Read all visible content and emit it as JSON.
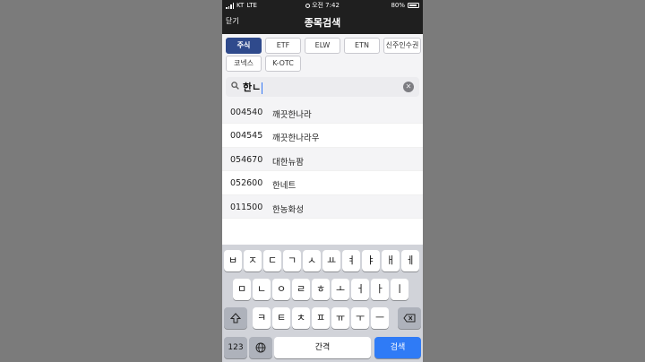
{
  "status": {
    "carrier": "KT",
    "network": "LTE",
    "time": "오전 7:42",
    "battery": "80%"
  },
  "header": {
    "close_label": "닫기",
    "title": "종목검색"
  },
  "filters": [
    "주식",
    "ETF",
    "ELW",
    "ETN",
    "신주인수권",
    "코넥스",
    "K-OTC"
  ],
  "active_filter": "주식",
  "search": {
    "value": "한ㄴ"
  },
  "results": [
    {
      "code": "004540",
      "name": "깨끗한나라"
    },
    {
      "code": "004545",
      "name": "깨끗한나라우"
    },
    {
      "code": "054670",
      "name": "대한뉴팜"
    },
    {
      "code": "052600",
      "name": "한네트"
    },
    {
      "code": "011500",
      "name": "한농화성"
    }
  ],
  "keyboard": {
    "row1": [
      "ㅂ",
      "ㅈ",
      "ㄷ",
      "ㄱ",
      "ㅅ",
      "ㅛ",
      "ㅕ",
      "ㅑ",
      "ㅐ",
      "ㅔ"
    ],
    "row2": [
      "ㅁ",
      "ㄴ",
      "ㅇ",
      "ㄹ",
      "ㅎ",
      "ㅗ",
      "ㅓ",
      "ㅏ",
      "ㅣ"
    ],
    "row3": [
      "ㅋ",
      "ㅌ",
      "ㅊ",
      "ㅍ",
      "ㅠ",
      "ㅜ",
      "ㅡ"
    ],
    "numbers_label": "123",
    "space_label": "간격",
    "search_label": "검색"
  },
  "colors": {
    "active_chip": "#2f4a8c",
    "search_key": "#2f7bf6",
    "header_bg": "#1f1f1f"
  },
  "icons": [
    "signal-icon",
    "alarm-icon",
    "battery-icon",
    "search-icon",
    "clear-icon",
    "shift-icon",
    "backspace-icon",
    "globe-icon"
  ]
}
